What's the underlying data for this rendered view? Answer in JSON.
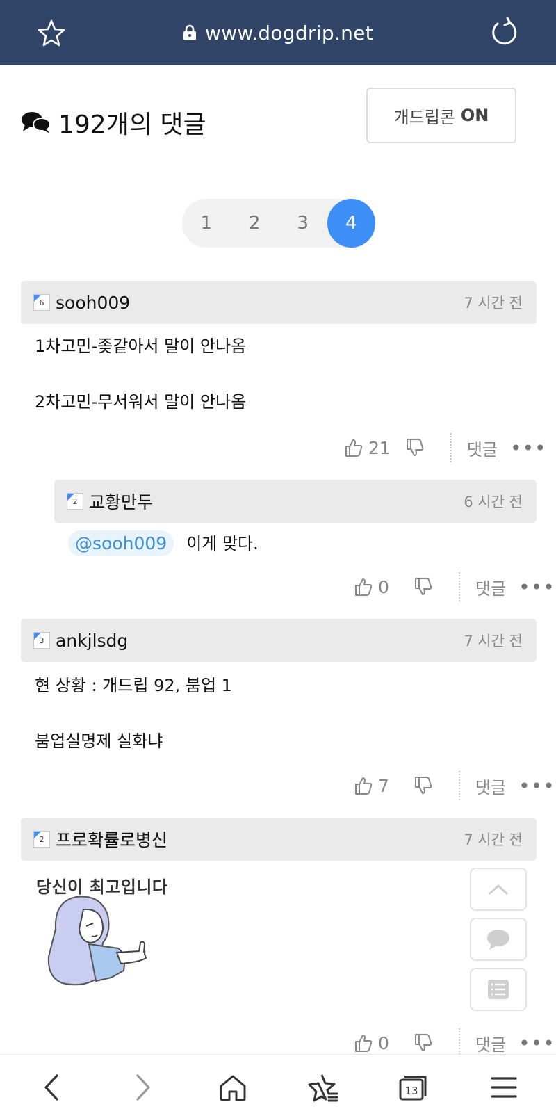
{
  "browser": {
    "url": "www.dogdrip.net",
    "tabs_count": "13",
    "icons": [
      "star-icon",
      "lock-icon",
      "reload-icon",
      "back-icon",
      "forward-icon",
      "home-icon",
      "bookmarks-icon",
      "tabs-icon",
      "menu-icon"
    ]
  },
  "comments_section": {
    "title": "192개의 댓글",
    "dogdrip_toggle_label": "개드립콘",
    "dogdrip_toggle_state": "ON"
  },
  "pagination": {
    "pages": [
      "1",
      "2",
      "3",
      "4"
    ],
    "active": "4"
  },
  "comments": [
    {
      "author": "sooh009",
      "level": "6",
      "time": "7 시간 전",
      "lines": [
        "1차고민-좆같아서 말이 안나옴",
        "",
        "2차고민-무서워서 말이 안나옴"
      ],
      "likes": "21",
      "reply_label": "댓글",
      "more": "•••"
    },
    {
      "author": "교황만두",
      "level": "2",
      "time": "6 시간 전",
      "mention": "@sooh009",
      "text": "이게 맞다.",
      "likes": "0",
      "reply_label": "댓글",
      "more": "•••"
    },
    {
      "author": "ankjlsdg",
      "level": "3",
      "time": "7 시간 전",
      "lines": [
        "현 상황 : 개드립 92, 붐업 1",
        "",
        "붐업실명제 실화냐"
      ],
      "likes": "7",
      "reply_label": "댓글",
      "more": "•••"
    },
    {
      "author": "프로확률로병신",
      "level": "2",
      "time": "7 시간 전",
      "sticker_text": "당신이 최고입니다",
      "likes": "0",
      "reply_label": "댓글",
      "more": "•••"
    }
  ],
  "colors": {
    "topbar": "#2f4466",
    "accent": "#3e8ef7",
    "mention_bg": "#e9f3fc",
    "mention_text": "#3d8fd6"
  }
}
